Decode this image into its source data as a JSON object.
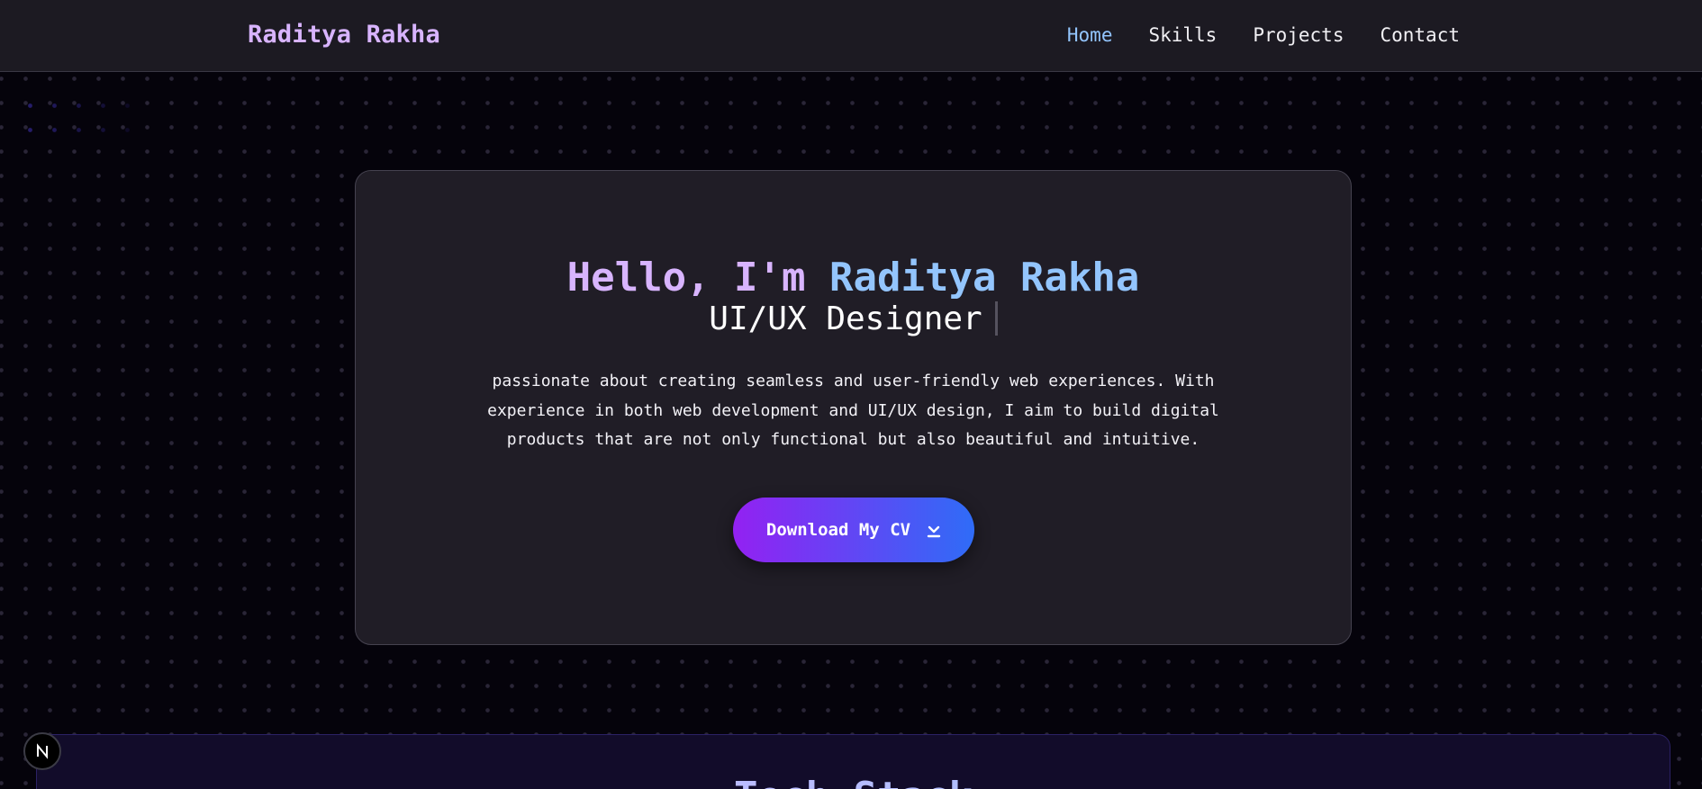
{
  "navbar": {
    "brand": "Raditya Rakha",
    "links": [
      {
        "label": "Home",
        "active": true
      },
      {
        "label": "Skills",
        "active": false
      },
      {
        "label": "Projects",
        "active": false
      },
      {
        "label": "Contact",
        "active": false
      }
    ]
  },
  "hero": {
    "greeting": "Hello, I'm ",
    "name": "Raditya Rakha",
    "role": "UI/UX Designer",
    "description": "passionate about creating seamless and user-friendly web experiences. With experience in both web development and UI/UX design, I aim to build digital products that are not only functional but also beautiful and intuitive.",
    "cv_button": {
      "label": "Download My CV",
      "icon": "download-icon"
    }
  },
  "tech_stack": {
    "title": "Tech Stack"
  },
  "dev_badge": {
    "icon": "nextjs-icon",
    "letter": "N"
  },
  "colors": {
    "accent_purple": "#d8b4fe",
    "accent_blue": "#93c5fd",
    "button_gradient_start": "#9321f2",
    "button_gradient_end": "#2f6cf7",
    "card_background": "#201d26",
    "page_background": "#05030b"
  }
}
